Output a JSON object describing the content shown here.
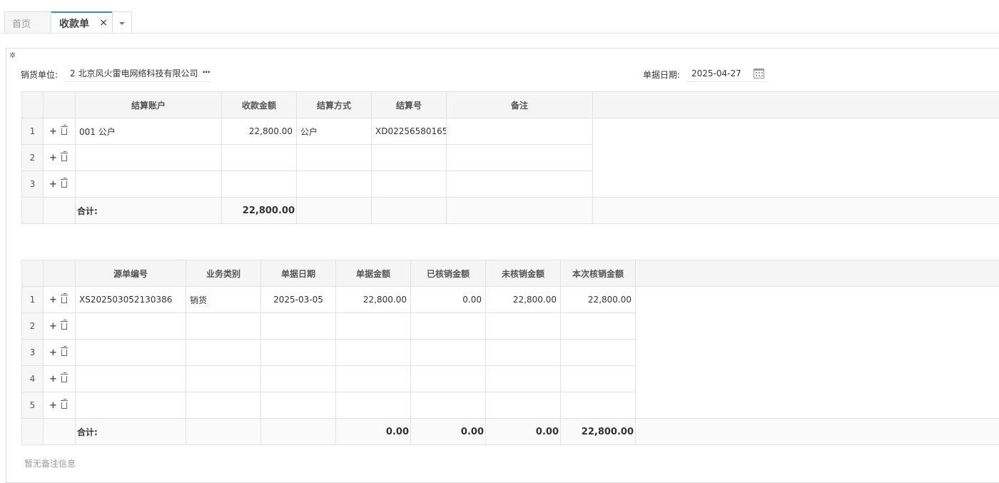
{
  "tabs": {
    "home": "首页",
    "active": "收款单",
    "close_glyph": "×"
  },
  "form": {
    "customer_label": "销货单位:",
    "customer_value": "2 北京风火雷电网络科技有限公司",
    "more_glyph": "···",
    "date_label": "单据日期:",
    "date_value": "2025-04-27"
  },
  "settlement": {
    "columns": [
      "结算账户",
      "收款金额",
      "结算方式",
      "结算号",
      "备注"
    ],
    "rows": [
      {
        "no": "1",
        "account": "001 公户",
        "amount": "22,800.00",
        "method": "公户",
        "settle_no": "XD02256580165",
        "note": ""
      },
      {
        "no": "2",
        "account": "",
        "amount": "",
        "method": "",
        "settle_no": "",
        "note": ""
      },
      {
        "no": "3",
        "account": "",
        "amount": "",
        "method": "",
        "settle_no": "",
        "note": ""
      }
    ],
    "total_label": "合计:",
    "total_amount": "22,800.00"
  },
  "source": {
    "columns": [
      "源单编号",
      "业务类别",
      "单据日期",
      "单据金额",
      "已核销金额",
      "未核销金额",
      "本次核销金额"
    ],
    "rows": [
      {
        "no": "1",
        "bill_no": "XS202503052130386",
        "type": "销货",
        "date": "2025-03-05",
        "amount": "22,800.00",
        "verified": "0.00",
        "unverified": "22,800.00",
        "this_time": "22,800.00"
      },
      {
        "no": "2",
        "bill_no": "",
        "type": "",
        "date": "",
        "amount": "",
        "verified": "",
        "unverified": "",
        "this_time": ""
      },
      {
        "no": "3",
        "bill_no": "",
        "type": "",
        "date": "",
        "amount": "",
        "verified": "",
        "unverified": "",
        "this_time": ""
      },
      {
        "no": "4",
        "bill_no": "",
        "type": "",
        "date": "",
        "amount": "",
        "verified": "",
        "unverified": "",
        "this_time": ""
      },
      {
        "no": "5",
        "bill_no": "",
        "type": "",
        "date": "",
        "amount": "",
        "verified": "",
        "unverified": "",
        "this_time": ""
      }
    ],
    "total_label": "合计:",
    "total_amount": "0.00",
    "total_verified": "0.00",
    "total_unverified": "0.00",
    "total_this_time": "22,800.00"
  },
  "remark": "暂无备注信息",
  "icons": {
    "add": "+",
    "gear": "✲"
  }
}
